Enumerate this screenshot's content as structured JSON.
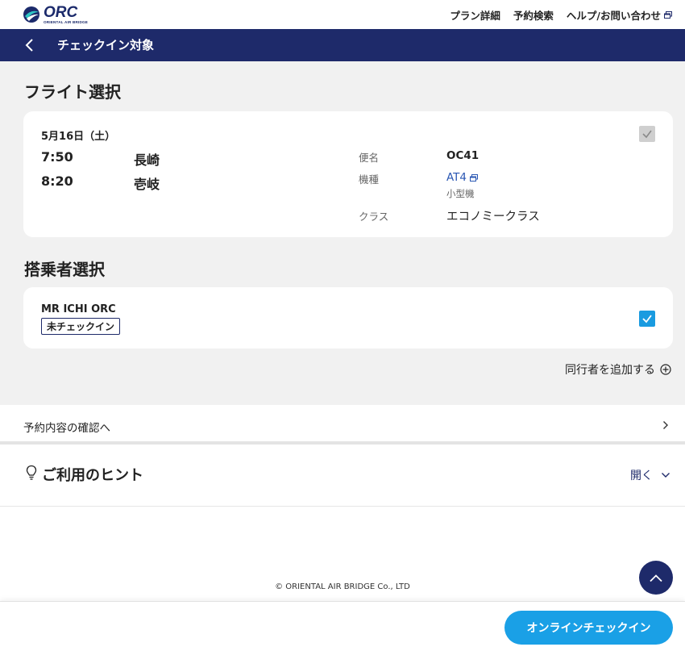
{
  "brand": {
    "logo_word": "ORC",
    "logo_sub": "ORIENTAL AIR BRIDGE"
  },
  "topnav": {
    "plan_details": "プラン詳細",
    "reservation_search": "予約検索",
    "help_contact": "ヘルプ/お問い合わせ"
  },
  "titlebar": {
    "title": "チェックイン対象"
  },
  "flight_section": {
    "heading": "フライト選択",
    "date": "5月16日（土）",
    "dep_time": "7:50",
    "dep_city": "長崎",
    "arr_time": "8:20",
    "arr_city": "壱岐",
    "flight_no_label": "便名",
    "flight_no": "OC41",
    "aircraft_label": "機種",
    "aircraft": "AT4",
    "aircraft_size": "小型機",
    "class_label": "クラス",
    "class": "エコノミークラス",
    "selected": true
  },
  "passenger_section": {
    "heading": "搭乗者選択",
    "passengers": [
      {
        "name": "MR ICHI ORC",
        "status": "未チェックイン",
        "selected": true
      }
    ],
    "add_companion": "同行者を追加する"
  },
  "confirm_link": "予約内容の確認へ",
  "hints": {
    "title": "ご利用のヒント",
    "toggle": "開く"
  },
  "footer": {
    "copyright": "© ORIENTAL AIR BRIDGE Co., LTD"
  },
  "cta": {
    "label": "オンラインチェックイン"
  },
  "colors": {
    "navy": "#1e2a6a",
    "accent_blue": "#1aa0e6",
    "checkbox_blue": "#1a9be0",
    "background_gray": "#f1f1f1"
  }
}
